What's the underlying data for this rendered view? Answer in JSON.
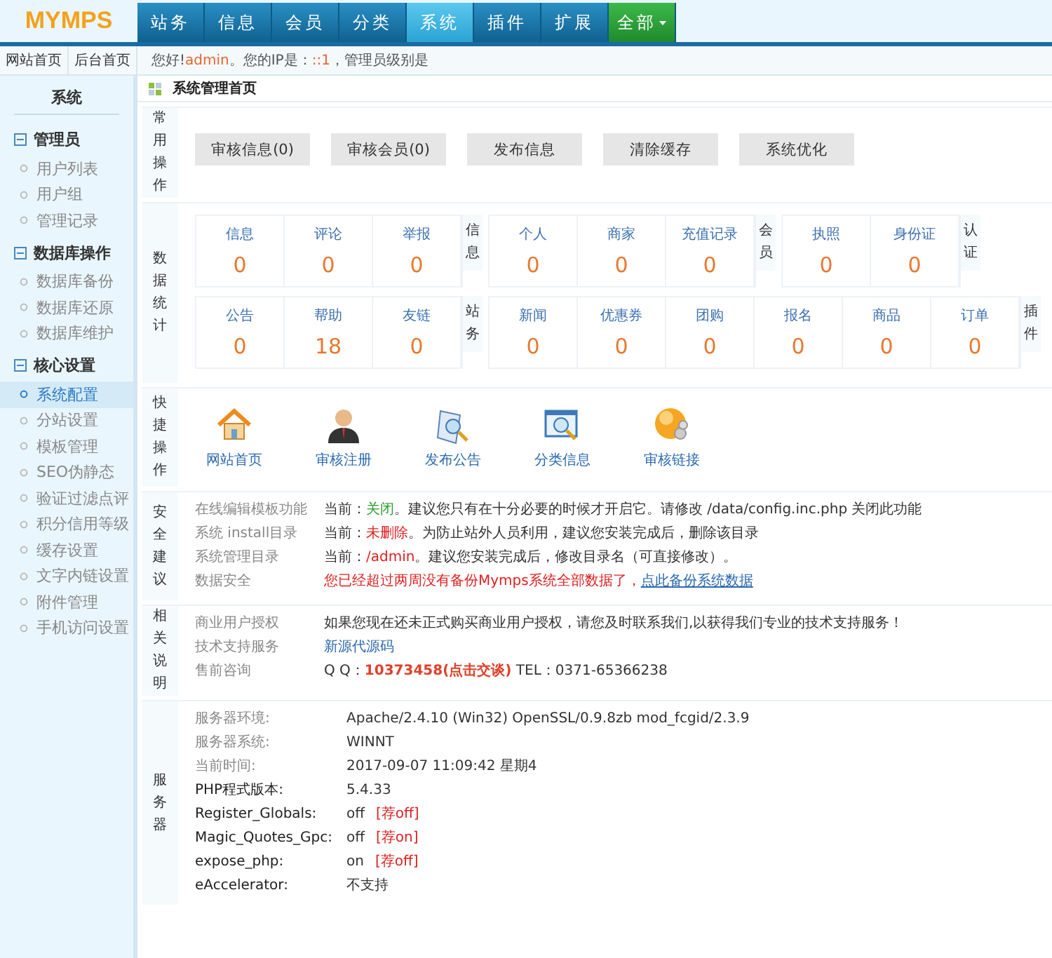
{
  "logo": "MYMPS",
  "nav": [
    {
      "label": "站务",
      "selected": false,
      "kind": "tab"
    },
    {
      "label": "信息",
      "selected": false,
      "kind": "tab"
    },
    {
      "label": "会员",
      "selected": false,
      "kind": "tab"
    },
    {
      "label": "分类",
      "selected": false,
      "kind": "tab"
    },
    {
      "label": "系统",
      "selected": true,
      "kind": "tab"
    },
    {
      "label": "插件",
      "selected": false,
      "kind": "tab"
    },
    {
      "label": "扩展",
      "selected": false,
      "kind": "tab"
    },
    {
      "label": "全部",
      "selected": false,
      "kind": "menu"
    }
  ],
  "quick_links": [
    "网站首页",
    "后台首页"
  ],
  "greeting": [
    {
      "text": "您好!",
      "kind": "plain"
    },
    {
      "text": "admin",
      "kind": "highlight"
    },
    {
      "text": "。您的IP是：",
      "kind": "plain"
    },
    {
      "text": "::1",
      "kind": "highlight"
    },
    {
      "text": "，管理员级别是",
      "kind": "plain"
    }
  ],
  "sidebar": {
    "title": "系统",
    "groups": [
      {
        "label": "管理员",
        "expanded": true,
        "items": [
          {
            "label": "用户列表",
            "selected": false
          },
          {
            "label": "用户组",
            "selected": false
          },
          {
            "label": "管理记录",
            "selected": false
          }
        ]
      },
      {
        "label": "数据库操作",
        "expanded": true,
        "items": [
          {
            "label": "数据库备份",
            "selected": false
          },
          {
            "label": "数据库还原",
            "selected": false
          },
          {
            "label": "数据库维护",
            "selected": false
          }
        ]
      },
      {
        "label": "核心设置",
        "expanded": true,
        "items": [
          {
            "label": "系统配置",
            "selected": true
          },
          {
            "label": "分站设置",
            "selected": false
          },
          {
            "label": "模板管理",
            "selected": false
          },
          {
            "label": "SEO伪静态",
            "selected": false
          },
          {
            "label": "验证过滤点评",
            "selected": false
          },
          {
            "label": "积分信用等级",
            "selected": false
          },
          {
            "label": "缓存设置",
            "selected": false
          },
          {
            "label": "文字内链设置",
            "selected": false
          },
          {
            "label": "附件管理",
            "selected": false
          },
          {
            "label": "手机访问设置",
            "selected": false
          }
        ]
      }
    ]
  },
  "page_title": "系统管理首页",
  "sections": [
    {
      "kind": "buttons",
      "label": "常用操作",
      "buttons": [
        "审核信息(0)",
        "审核会员(0)",
        "发布信息",
        "清除缓存",
        "系统优化"
      ]
    },
    {
      "kind": "stats",
      "label": "数据统计",
      "rows": [
        [
          {
            "label": "信息",
            "items": [
              {
                "name": "信息",
                "value": "0"
              },
              {
                "name": "评论",
                "value": "0"
              },
              {
                "name": "举报",
                "value": "0"
              }
            ]
          },
          {
            "label": "会员",
            "items": [
              {
                "name": "个人",
                "value": "0"
              },
              {
                "name": "商家",
                "value": "0"
              },
              {
                "name": "充值记录",
                "value": "0"
              }
            ]
          },
          {
            "label": "认证",
            "items": [
              {
                "name": "执照",
                "value": "0"
              },
              {
                "name": "身份证",
                "value": "0"
              }
            ]
          }
        ],
        [
          {
            "label": "站务",
            "items": [
              {
                "name": "公告",
                "value": "0"
              },
              {
                "name": "帮助",
                "value": "18"
              },
              {
                "name": "友链",
                "value": "0"
              }
            ]
          },
          {
            "label": "插件",
            "items": [
              {
                "name": "新闻",
                "value": "0"
              },
              {
                "name": "优惠券",
                "value": "0"
              },
              {
                "name": "团购",
                "value": "0"
              },
              {
                "name": "报名",
                "value": "0"
              },
              {
                "name": "商品",
                "value": "0"
              },
              {
                "name": "订单",
                "value": "0"
              }
            ]
          }
        ]
      ]
    },
    {
      "kind": "shortcuts",
      "label": "快捷操作",
      "items": [
        {
          "label": "网站首页"
        },
        {
          "label": "审核注册"
        },
        {
          "label": "发布公告"
        },
        {
          "label": "分类信息"
        },
        {
          "label": "审核链接"
        }
      ]
    },
    {
      "kind": "rows",
      "label": "安全建议",
      "rows": [
        {
          "label": "在线编辑模板功能",
          "parts": [
            {
              "text": "当前：",
              "kind": "plain"
            },
            {
              "text": "关闭",
              "kind": "green"
            },
            {
              "text": "。建议您只有在十分必要的时候才开启它。请修改 /data/config.inc.php 关闭此功能",
              "kind": "plain"
            }
          ]
        },
        {
          "label": "系统 install目录",
          "parts": [
            {
              "text": "当前：",
              "kind": "plain"
            },
            {
              "text": "未删除",
              "kind": "red"
            },
            {
              "text": "。为防止站外人员利用，建议您安装完成后，删除该目录",
              "kind": "plain"
            }
          ]
        },
        {
          "label": "系统管理目录",
          "parts": [
            {
              "text": "当前：",
              "kind": "plain"
            },
            {
              "text": "/admin",
              "kind": "red"
            },
            {
              "text": "。建议您安装完成后，修改目录名（可直接修改）。",
              "kind": "plain"
            }
          ]
        },
        {
          "label": "数据安全",
          "parts": [
            {
              "text": "您已经超过两周没有备份Mymps系统全部数据了，",
              "kind": "red"
            },
            {
              "text": "点此备份系统数据",
              "kind": "link"
            }
          ]
        }
      ]
    },
    {
      "kind": "rows",
      "label": "相关说明",
      "rows": [
        {
          "label": "商业用户授权",
          "parts": [
            {
              "text": "如果您现在还未正式购买商业用户授权，请您及时联系我们,以获得我们专业的技术支持服务！",
              "kind": "plain"
            }
          ]
        },
        {
          "label": "技术支持服务",
          "parts": [
            {
              "text": "新源代源码",
              "kind": "blue"
            }
          ]
        },
        {
          "label": "售前咨询",
          "parts": [
            {
              "text": "Q Q：",
              "kind": "plain"
            },
            {
              "text": "10373458(点击交谈)",
              "kind": "strong"
            },
            {
              "text": " TEL：0371-65366238",
              "kind": "plain"
            }
          ]
        }
      ]
    },
    {
      "kind": "rows",
      "label": "服务器",
      "rows": [
        {
          "label": "服务器环境:",
          "parts": [
            {
              "text": "Apache/2.4.10 (Win32) OpenSSL/0.9.8zb mod_fcgid/2.3.9",
              "kind": "plain"
            }
          ]
        },
        {
          "label": "服务器系统:",
          "parts": [
            {
              "text": "WINNT",
              "kind": "plain"
            }
          ]
        },
        {
          "label": "当前时间:",
          "parts": [
            {
              "text": "2017-09-07 11:09:42 星期4",
              "kind": "plain"
            }
          ]
        },
        {
          "label": "PHP程式版本:",
          "dark": true,
          "parts": [
            {
              "text": "5.4.33",
              "kind": "plain"
            }
          ]
        },
        {
          "label": "Register_Globals:",
          "dark": true,
          "parts": [
            {
              "text": "off",
              "kind": "plain"
            },
            {
              "text": "[荐off]",
              "kind": "note"
            }
          ]
        },
        {
          "label": "Magic_Quotes_Gpc:",
          "dark": true,
          "parts": [
            {
              "text": "off",
              "kind": "plain"
            },
            {
              "text": "[荐on]",
              "kind": "note"
            }
          ]
        },
        {
          "label": "expose_php:",
          "dark": true,
          "parts": [
            {
              "text": "on",
              "kind": "plain"
            },
            {
              "text": "[荐off]",
              "kind": "note"
            }
          ]
        },
        {
          "label": "eAccelerator:",
          "dark": true,
          "parts": [
            {
              "text": "不支持",
              "kind": "plain"
            }
          ]
        }
      ]
    }
  ]
}
